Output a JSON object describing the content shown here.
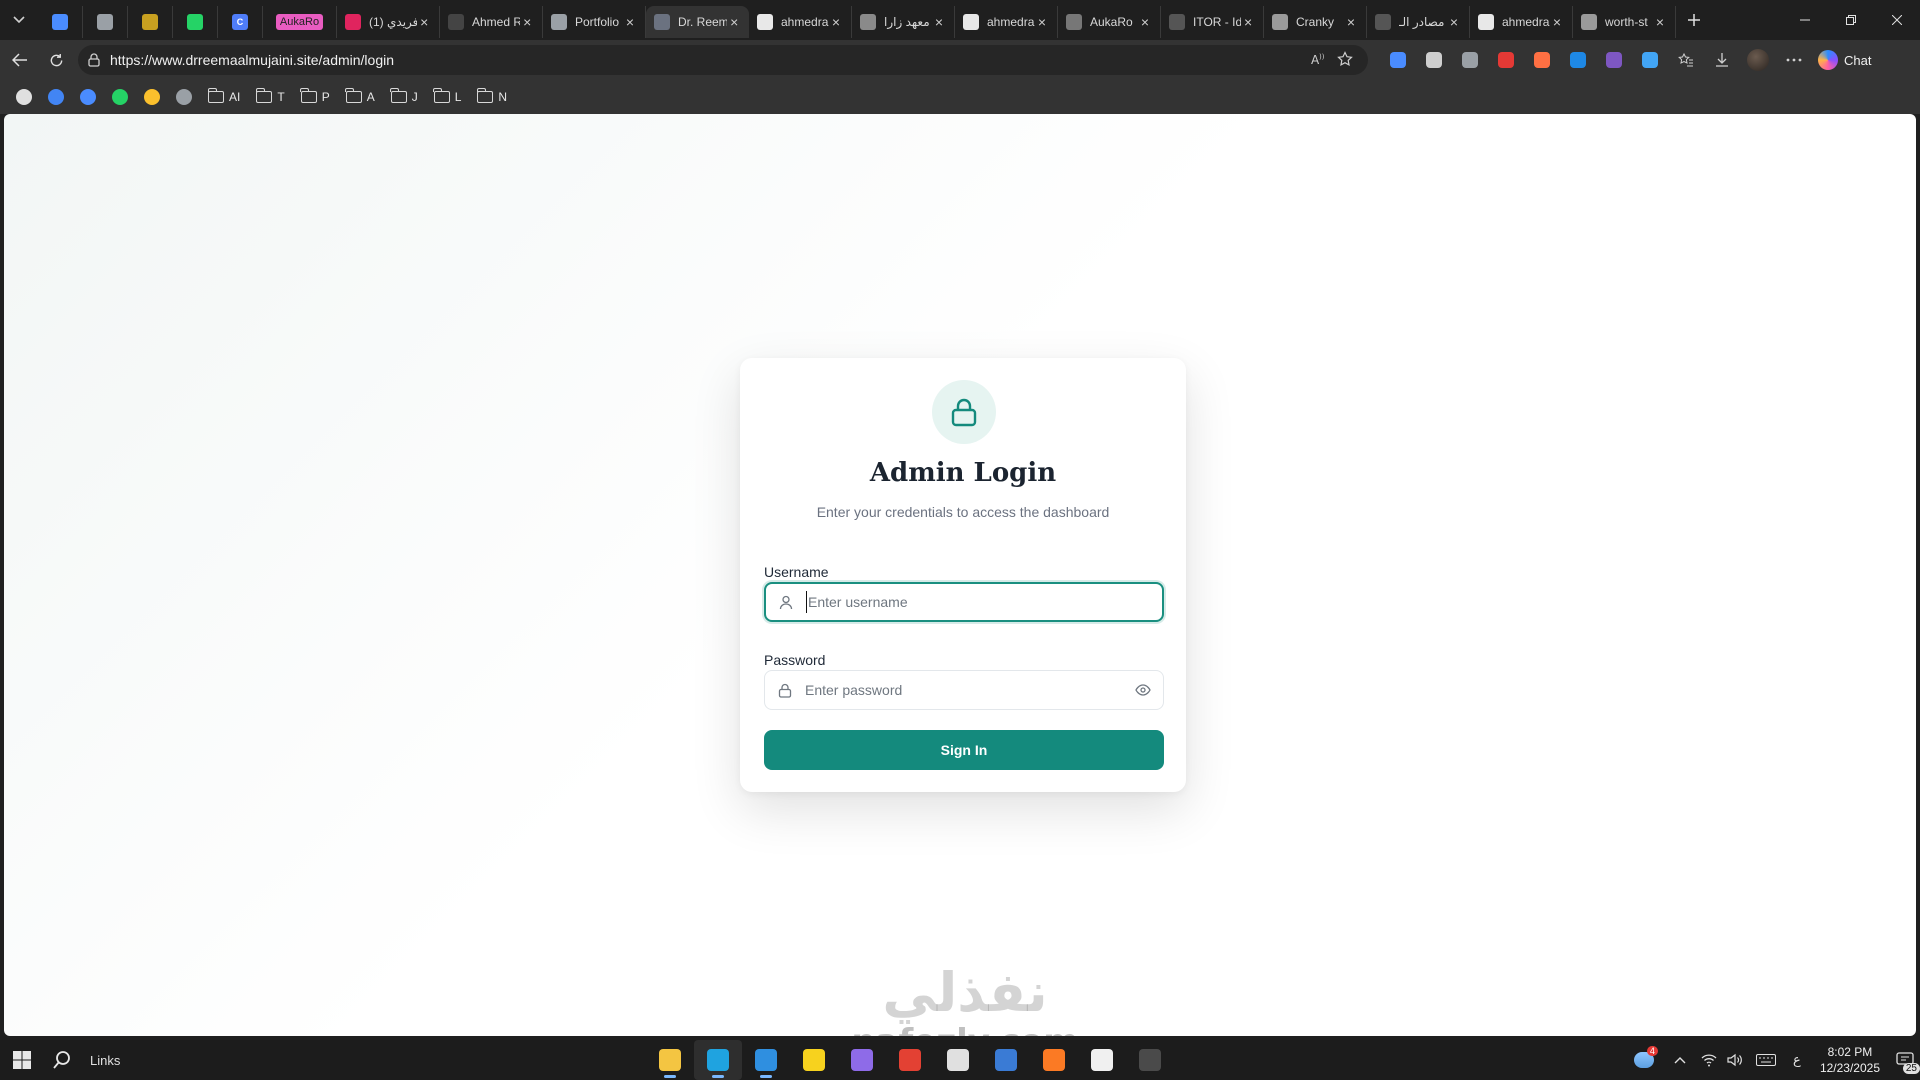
{
  "browser": {
    "tabs": [
      {
        "kind": "pinned",
        "title": "",
        "favicon_color": "#4a8cff",
        "close": false
      },
      {
        "kind": "pinned",
        "title": "",
        "favicon_color": "#9aa0a6",
        "close": false
      },
      {
        "kind": "pinned",
        "title": "",
        "favicon_color": "#c8a020",
        "close": false
      },
      {
        "kind": "pinned",
        "title": "",
        "favicon_color": "#25d366",
        "close": false
      },
      {
        "kind": "pinned",
        "title": "C",
        "favicon_color": "#4f7df9",
        "close": false
      },
      {
        "kind": "pinned-badge",
        "title": "AukaRo",
        "favicon_color": "#e95cc1",
        "close": false
      },
      {
        "kind": "normal",
        "title": "(1) فريدي",
        "favicon_color": "#e0245e",
        "close": true
      },
      {
        "kind": "normal",
        "title": "Ahmed R",
        "favicon_color": "#444444",
        "close": true
      },
      {
        "kind": "normal",
        "title": "Portfolio",
        "favicon_color": "#9aa0a6",
        "close": true
      },
      {
        "kind": "active",
        "title": "Dr. Reem",
        "favicon_color": "#6b7280",
        "close": true
      },
      {
        "kind": "normal",
        "title": "ahmedra",
        "favicon_color": "#e8e8e8",
        "close": true
      },
      {
        "kind": "normal",
        "title": "معهد زارا",
        "favicon_color": "#8a8a8a",
        "close": true
      },
      {
        "kind": "normal",
        "title": "ahmedra",
        "favicon_color": "#e8e8e8",
        "close": true
      },
      {
        "kind": "normal",
        "title": "AukaRo",
        "favicon_color": "#777777",
        "close": true
      },
      {
        "kind": "normal",
        "title": "ITOR - Id",
        "favicon_color": "#555555",
        "close": true
      },
      {
        "kind": "normal",
        "title": "Cranky",
        "favicon_color": "#9a9a9a",
        "close": true
      },
      {
        "kind": "normal",
        "title": "مصادر الـ",
        "favicon_color": "#555555",
        "close": true
      },
      {
        "kind": "normal",
        "title": "ahmedra",
        "favicon_color": "#e8e8e8",
        "close": true
      },
      {
        "kind": "normal",
        "title": "worth-st",
        "favicon_color": "#9a9a9a",
        "close": true
      }
    ],
    "url": "https://www.drreemaalmujaini.site/admin/login",
    "chat_label": "Chat",
    "extensions": [
      "#4a8cff",
      "#cfcfcf",
      "#9aa0a6",
      "#e53935",
      "#ff7043",
      "#1e88e5",
      "#7e57c2",
      "#42a5f5"
    ],
    "bookmarks": [
      {
        "type": "icon",
        "label": "",
        "color": "#e0e0e0"
      },
      {
        "type": "icon",
        "label": "",
        "color": "#4285f4"
      },
      {
        "type": "icon",
        "label": "",
        "color": "#4a8cff"
      },
      {
        "type": "icon",
        "label": "",
        "color": "#25d366"
      },
      {
        "type": "icon",
        "label": "",
        "color": "#fbc02d"
      },
      {
        "type": "icon",
        "label": "",
        "color": "#9aa0a6"
      },
      {
        "type": "folder",
        "label": "AI"
      },
      {
        "type": "folder",
        "label": "T"
      },
      {
        "type": "folder",
        "label": "P"
      },
      {
        "type": "folder",
        "label": "A"
      },
      {
        "type": "folder",
        "label": "J"
      },
      {
        "type": "folder",
        "label": "L"
      },
      {
        "type": "folder",
        "label": "N"
      }
    ]
  },
  "login": {
    "title": "Admin Login",
    "subtitle": "Enter your credentials to access the dashboard",
    "username_label": "Username",
    "username_placeholder": "Enter username",
    "password_label": "Password",
    "password_placeholder": "Enter password",
    "submit_label": "Sign In",
    "accent": "#148a7d"
  },
  "watermark": {
    "arabic": "نفذلي",
    "latin": "nafezly.com"
  },
  "taskbar": {
    "search_label": "Links",
    "apps": [
      {
        "name": "file-explorer",
        "color": "#f4c542",
        "running": true,
        "active": false
      },
      {
        "name": "edge",
        "color": "#1fa3e0",
        "running": true,
        "active": true
      },
      {
        "name": "vscode",
        "color": "#2f8fe0",
        "running": true,
        "active": false
      },
      {
        "name": "sticky-notes",
        "color": "#f7d21e",
        "running": false,
        "active": false
      },
      {
        "name": "github-desktop",
        "color": "#8e6be8",
        "running": false,
        "active": false
      },
      {
        "name": "chrome",
        "color": "#e34133",
        "running": false,
        "active": false
      },
      {
        "name": "app-dark",
        "color": "#e0e0e0",
        "running": false,
        "active": false
      },
      {
        "name": "app-blue",
        "color": "#3a7bd5",
        "running": false,
        "active": false
      },
      {
        "name": "xampp",
        "color": "#fb7a24",
        "running": false,
        "active": false
      },
      {
        "name": "store",
        "color": "#f0f0f0",
        "running": false,
        "active": false
      },
      {
        "name": "terminal",
        "color": "#4a4a4a",
        "running": false,
        "active": false
      }
    ],
    "weather_badge": "4",
    "lang": "ع",
    "time": "8:02 PM",
    "date": "12/23/2025",
    "notifications": "25"
  }
}
